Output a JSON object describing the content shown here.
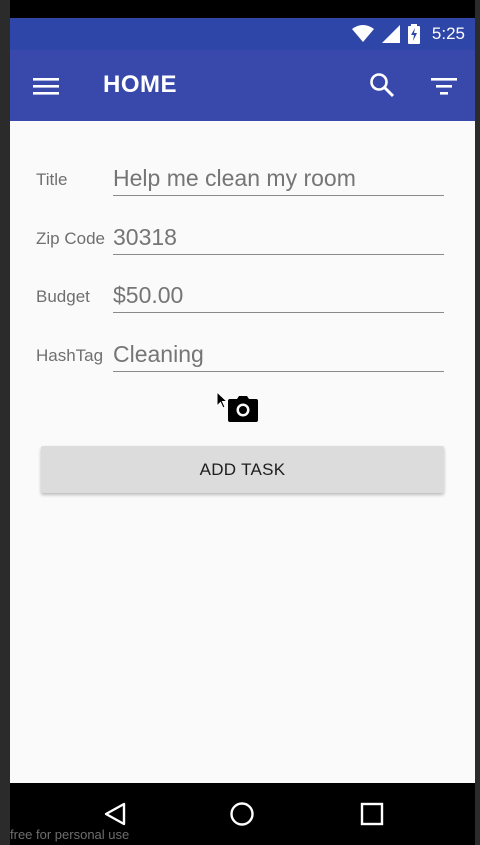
{
  "status_bar": {
    "time": "5:25",
    "icons": [
      "wifi-icon",
      "cellular-signal-icon",
      "battery-charging-icon"
    ]
  },
  "app_bar": {
    "title": "HOME",
    "icons": [
      "menu-icon",
      "search-icon",
      "filter-icon"
    ]
  },
  "form": {
    "fields": [
      {
        "label": "Title",
        "value": "Help me clean my room"
      },
      {
        "label": "Zip Code",
        "value": "30318"
      },
      {
        "label": "Budget",
        "value": "$50.00"
      },
      {
        "label": "HashTag",
        "value": "Cleaning"
      }
    ],
    "camera_icon": "camera-icon",
    "submit_label": "ADD TASK"
  },
  "nav_bar": {
    "icons": [
      "back-icon",
      "home-icon",
      "recent-apps-icon"
    ]
  },
  "watermark": "free for personal use",
  "colors": {
    "app_bar": "#3849ab",
    "status_bar": "#2e46a8",
    "background": "#fafafa",
    "button": "#dcdcdc"
  }
}
